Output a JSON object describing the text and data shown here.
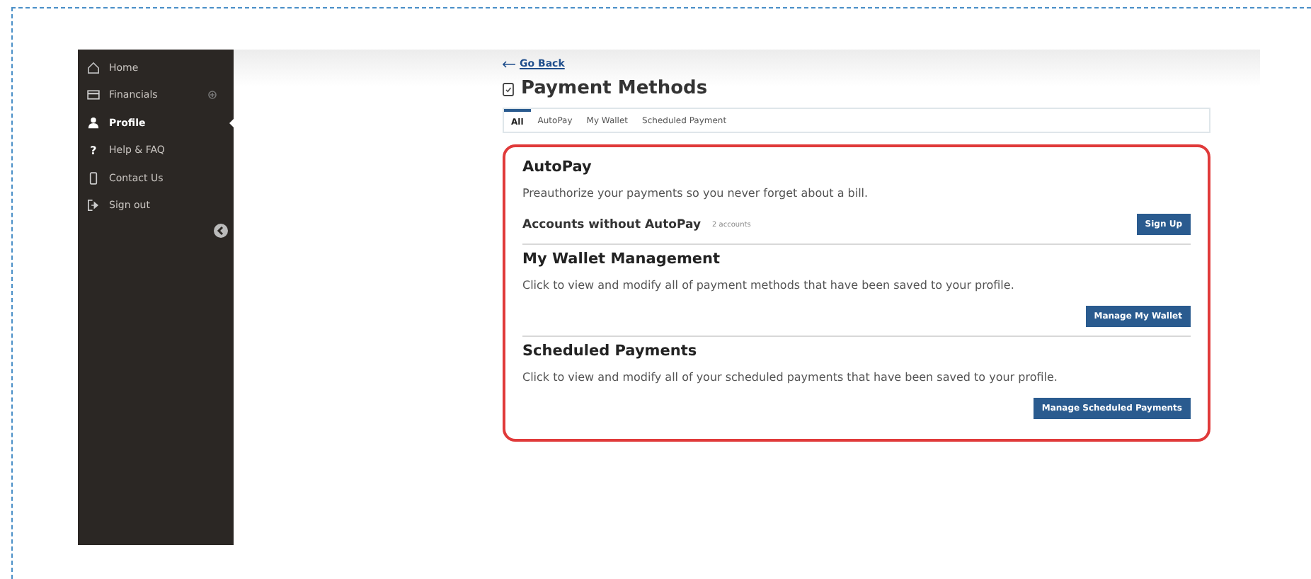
{
  "sidebar": {
    "items": [
      {
        "label": "Home",
        "kind": "house",
        "selected": false,
        "expandable": false
      },
      {
        "label": "Financials",
        "kind": "card",
        "selected": false,
        "expandable": true
      },
      {
        "label": "Profile",
        "kind": "person",
        "selected": true,
        "expandable": false
      },
      {
        "label": "Help & FAQ",
        "kind": "text",
        "icon_text": "?",
        "selected": false,
        "expandable": false
      },
      {
        "label": "Contact Us",
        "kind": "phone",
        "selected": false,
        "expandable": false
      },
      {
        "label": "Sign out",
        "kind": "signout",
        "selected": false,
        "expandable": false
      }
    ]
  },
  "back_link": "Go Back",
  "page_title": "Payment Methods",
  "tabs": [
    {
      "label": "All",
      "selected": true
    },
    {
      "label": "AutoPay",
      "selected": false
    },
    {
      "label": "My Wallet",
      "selected": false
    },
    {
      "label": "Scheduled Payment",
      "selected": false
    }
  ],
  "sections": [
    {
      "kind": "inline",
      "title": "AutoPay",
      "description": "Preauthorize your payments so you never forget about a bill.",
      "subheading": "Accounts without AutoPay",
      "count": "2 accounts",
      "button": "Sign Up"
    },
    {
      "kind": "stacked",
      "title": "My Wallet Management",
      "description": "Click to view and modify all of payment methods that have been saved to your profile.",
      "button": "Manage My Wallet"
    },
    {
      "kind": "stacked",
      "title": "Scheduled Payments",
      "description": "Click to view and modify all of your scheduled payments that have been saved to your profile.",
      "button": "Manage Scheduled Payments"
    }
  ]
}
